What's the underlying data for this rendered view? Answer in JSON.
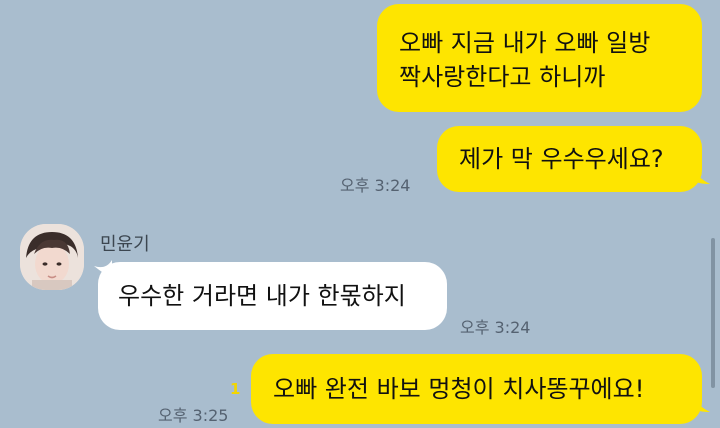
{
  "theme": {
    "background": "#a9bdce",
    "my_bubble": "#fee500",
    "other_bubble": "#ffffff",
    "time_color": "#556271",
    "unread_color": "#f2d600"
  },
  "messages": [
    {
      "side": "me",
      "lines": [
        "오빠 지금 내가 오빠 일방",
        "짝사랑한다고 하니까"
      ]
    },
    {
      "side": "me",
      "text": "제가 막 우수우세요?",
      "time": "오후 3:24"
    },
    {
      "side": "other",
      "sender": "민윤기",
      "avatar_icon": "profile-avatar-icon",
      "text": "우수한 거라면 내가 한몫하지",
      "time": "오후 3:24"
    },
    {
      "side": "me",
      "text": "오빠 완전 바보 멍청이 치사똥꾸에요!",
      "time": "오후 3:25",
      "unread": "1"
    }
  ]
}
